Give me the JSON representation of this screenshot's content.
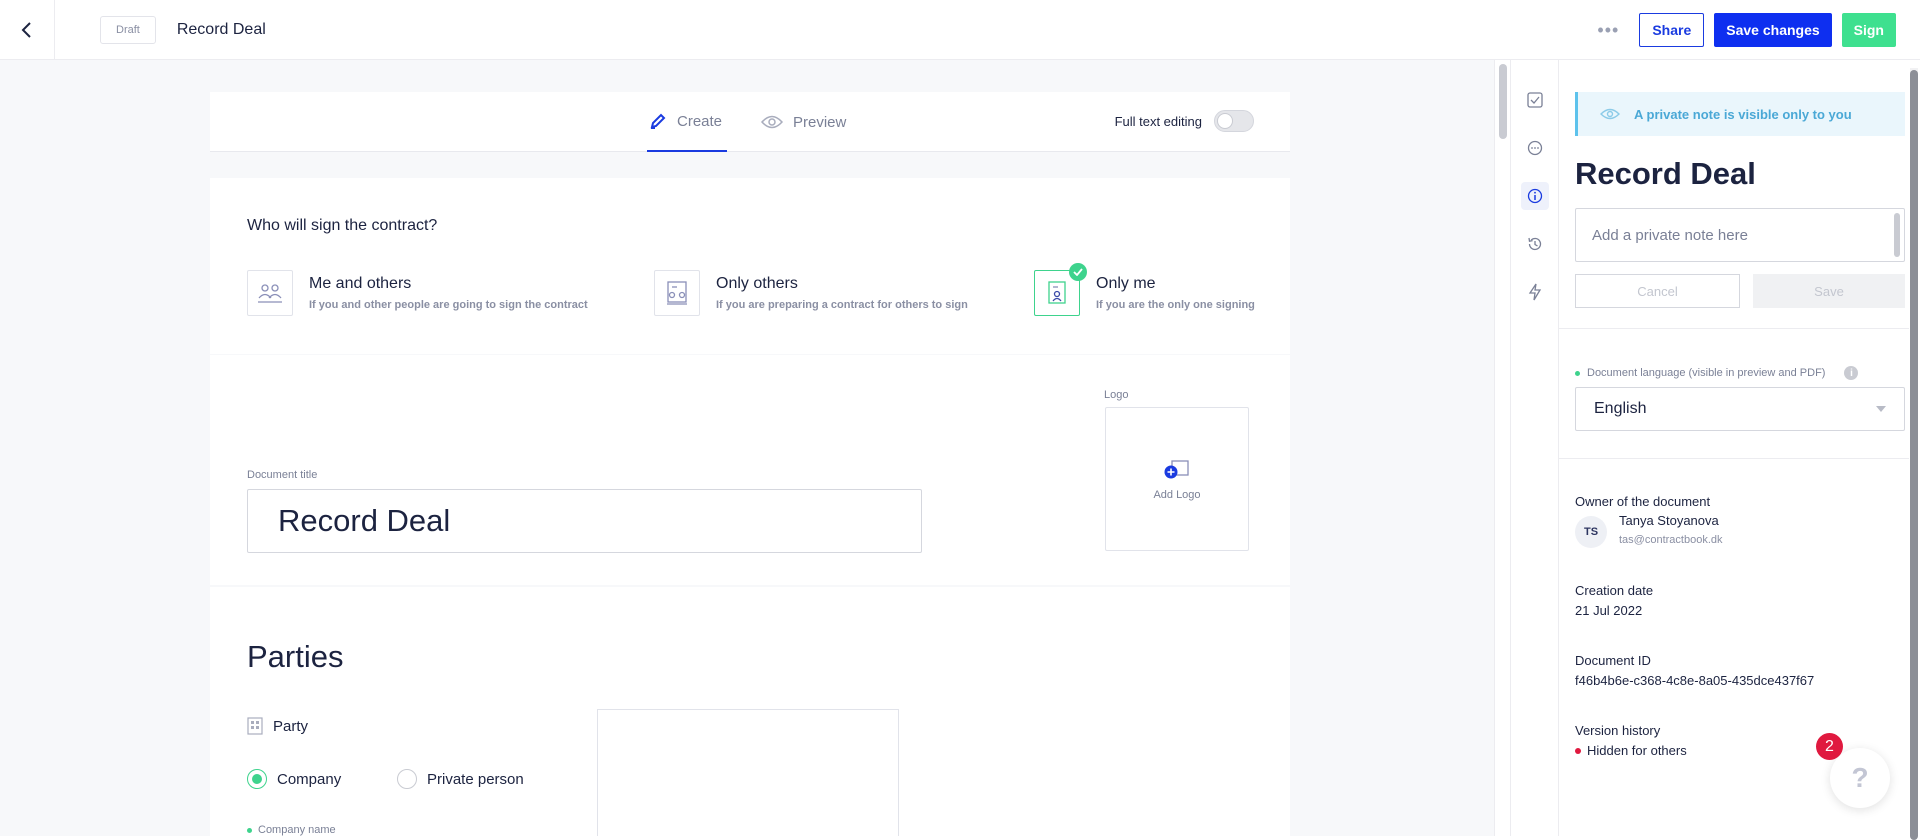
{
  "header": {
    "status_badge": "Draft",
    "doc_title": "Record Deal",
    "share_label": "Share",
    "save_label": "Save changes",
    "sign_label": "Sign"
  },
  "editor": {
    "tabs": [
      {
        "label": "Create",
        "icon": "pencil-icon",
        "active": true
      },
      {
        "label": "Preview",
        "icon": "eye-icon",
        "active": false
      }
    ],
    "full_text_editing_label": "Full text editing",
    "full_text_editing_on": false,
    "signers": {
      "question": "Who will sign the contract?",
      "options": [
        {
          "title": "Me and others",
          "subtitle": "If you and other people are going to sign the contract",
          "icon": "group-people-icon",
          "selected": false
        },
        {
          "title": "Only others",
          "subtitle": "If you are preparing a contract for others to sign",
          "icon": "others-document-icon",
          "selected": false
        },
        {
          "title": "Only me",
          "subtitle": "If you are the only one signing",
          "icon": "me-document-icon",
          "selected": true
        }
      ]
    },
    "title_section": {
      "logo_label": "Logo",
      "add_logo_label": "Add Logo",
      "doc_title_label": "Document title",
      "doc_title_value": "Record Deal"
    },
    "parties": {
      "heading": "Parties",
      "party_label": "Party",
      "company_label": "Company",
      "private_label": "Private person",
      "selected": "Company",
      "company_name_label": "Company name"
    }
  },
  "sidebar": {
    "rail_icons": [
      "checklist-icon",
      "comment-icon",
      "info-icon",
      "history-icon",
      "automation-icon"
    ],
    "note_banner": "A private note is visible only to you",
    "title": "Record Deal",
    "note_placeholder": "Add a private note here",
    "cancel_label": "Cancel",
    "save_label": "Save",
    "language_label": "Document language (visible in preview and PDF)",
    "language_value": "English",
    "owner_heading": "Owner of the document",
    "owner_initials": "TS",
    "owner_name": "Tanya Stoyanova",
    "owner_email": "tas@contractbook.dk",
    "creation_heading": "Creation date",
    "creation_value": "21 Jul 2022",
    "docid_heading": "Document ID",
    "docid_value": "f46b4b6e-c368-4c8e-8a05-435dce437f67",
    "version_heading": "Version history",
    "version_value": "Hidden for others"
  },
  "help": {
    "badge_count": "2",
    "icon": "?"
  },
  "colors": {
    "brand_blue": "#0e2ff0",
    "sign_green": "#3ee08f",
    "accent_green": "#3ed38d",
    "alert_red": "#e0193f"
  }
}
